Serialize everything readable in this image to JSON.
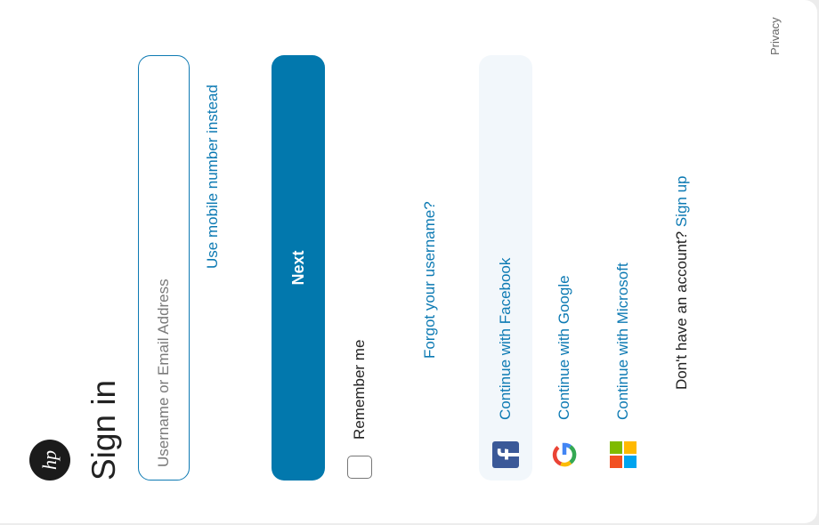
{
  "brand": {
    "logo_text": "hp"
  },
  "title": "Sign in",
  "username": {
    "placeholder": "Username or Email Address",
    "value": ""
  },
  "mobile_link": "Use mobile number instead",
  "next_label": "Next",
  "remember_label": "Remember me",
  "forgot_link": "Forgot your username?",
  "social": {
    "facebook": "Continue with Facebook",
    "google": "Continue with Google",
    "microsoft": "Continue with Microsoft"
  },
  "signup": {
    "prompt": "Don't have an account?",
    "link": "Sign up"
  },
  "privacy": "Privacy",
  "colors": {
    "accent": "#0278ad",
    "link": "#0d7ab3",
    "panel": "#f2f7fb"
  }
}
